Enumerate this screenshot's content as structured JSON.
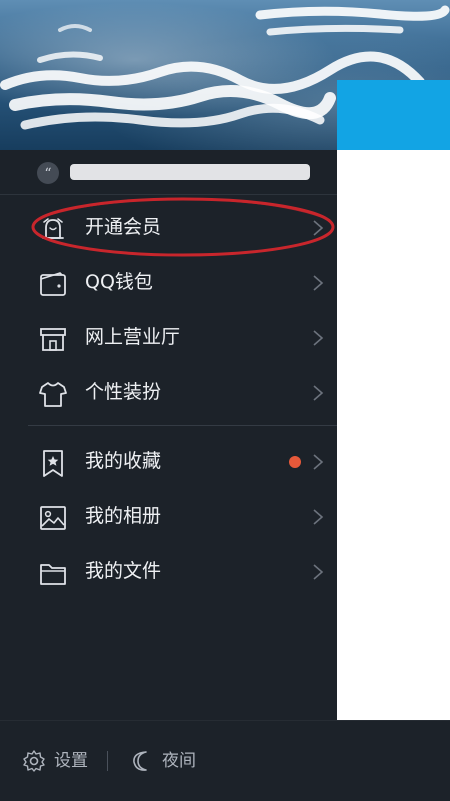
{
  "signature": {
    "quote_glyph": "“"
  },
  "menu": {
    "items": [
      {
        "label": "开通会员",
        "icon": "vip-bell-icon"
      },
      {
        "label": "QQ钱包",
        "icon": "wallet-icon"
      },
      {
        "label": "网上营业厅",
        "icon": "store-icon"
      },
      {
        "label": "个性装扮",
        "icon": "tshirt-icon"
      },
      {
        "label": "我的收藏",
        "icon": "bookmark-star-icon",
        "badge": "new-dot"
      },
      {
        "label": "我的相册",
        "icon": "image-icon"
      },
      {
        "label": "我的文件",
        "icon": "folder-icon"
      }
    ]
  },
  "bottom_bar": {
    "settings_label": "设置",
    "night_label": "夜间"
  },
  "colors": {
    "drawer_background": "#1c2229",
    "accent_blue": "#12a4e4",
    "annotation_red": "#c8262c",
    "badge_dot": "#e6593a"
  }
}
